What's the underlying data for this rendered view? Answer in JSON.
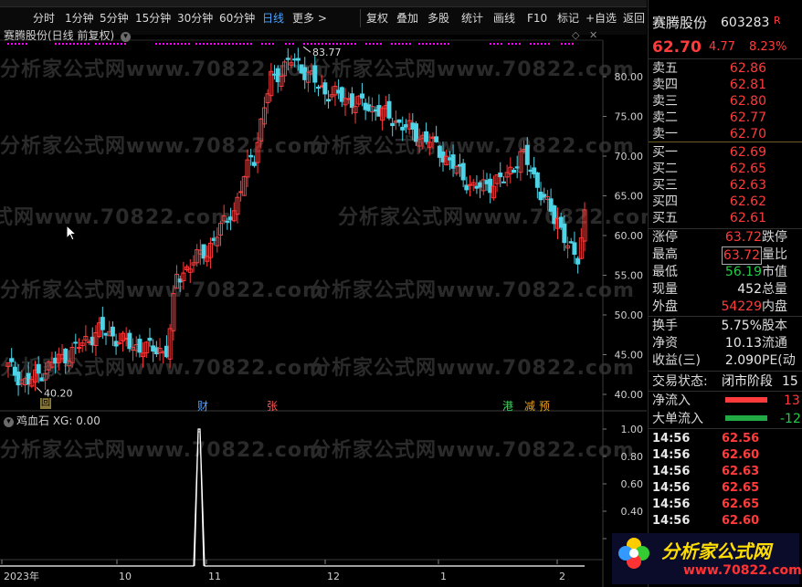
{
  "toolbar": {
    "periods": [
      "分时",
      "1分钟",
      "5分钟",
      "15分钟",
      "30分钟",
      "60分钟",
      "日线",
      "更多 >"
    ],
    "active_period": "日线",
    "actions": [
      "复权",
      "叠加",
      "多股",
      "统计",
      "画线",
      "F10",
      "标记",
      "+自选",
      "返回"
    ]
  },
  "chart": {
    "title": "赛腾股份(日线 前复权)",
    "high_label": "83.77",
    "low_label": "40.20",
    "y_ticks": [
      "80.00",
      "75.00",
      "70.00",
      "65.00",
      "60.00",
      "55.00",
      "50.00",
      "45.00",
      "40.00"
    ],
    "events": [
      "回",
      "财",
      "张",
      "港",
      "减",
      "预"
    ],
    "indicator_title": "鸡血石 XG: 0.00",
    "indicator_ticks": [
      "1.00",
      "0.80",
      "0.60",
      "0.40",
      "0.20"
    ],
    "x_labels": [
      "2023年",
      "10",
      "11",
      "12",
      "1",
      "2"
    ],
    "watermark": "分析家公式网www.70822.com",
    "colors": {
      "up": "#ff3b3b",
      "down": "#4fd3e6",
      "dots": "#ff00ff",
      "bg": "#000000"
    }
  },
  "panel": {
    "name": "赛腾股份",
    "code": "603283",
    "flag": "R",
    "price": "62.70",
    "change": "4.77",
    "pct": "8.23%",
    "asks": [
      {
        "label": "卖五",
        "price": "62.86"
      },
      {
        "label": "卖四",
        "price": "62.81"
      },
      {
        "label": "卖三",
        "price": "62.80"
      },
      {
        "label": "卖二",
        "price": "62.77"
      },
      {
        "label": "卖一",
        "price": "62.70"
      }
    ],
    "bids": [
      {
        "label": "买一",
        "price": "62.69"
      },
      {
        "label": "买二",
        "price": "62.65"
      },
      {
        "label": "买三",
        "price": "62.63"
      },
      {
        "label": "买四",
        "price": "62.62"
      },
      {
        "label": "买五",
        "price": "62.61"
      }
    ],
    "stats": [
      {
        "l": "涨停",
        "v": "63.72",
        "r": "跌停",
        "c": "red"
      },
      {
        "l": "最高",
        "v": "63.72",
        "r": "量比",
        "c": "red"
      },
      {
        "l": "最低",
        "v": "56.19",
        "r": "市值",
        "c": "green"
      },
      {
        "l": "现量",
        "v": "452",
        "r": "总量",
        "c": "white"
      },
      {
        "l": "外盘",
        "v": "54229",
        "r": "内盘",
        "c": "red"
      }
    ],
    "stats2": [
      {
        "l": "换手",
        "v": "5.75%",
        "r": "股本",
        "c": "white"
      },
      {
        "l": "净资",
        "v": "10.13",
        "r": "流通",
        "c": "white"
      },
      {
        "l": "收益(三)",
        "v": "2.090",
        "r": "PE(动",
        "c": "white"
      }
    ],
    "status_label": "交易状态:",
    "status_value": "闭市阶段",
    "status_num": "15",
    "flows": [
      {
        "label": "净流入",
        "value": "13",
        "color": "red"
      },
      {
        "label": "大单流入",
        "value": "-12",
        "color": "green"
      }
    ],
    "ticks": [
      {
        "t": "14:56",
        "p": "62.56"
      },
      {
        "t": "14:56",
        "p": "62.60"
      },
      {
        "t": "14:56",
        "p": "62.63"
      },
      {
        "t": "14:56",
        "p": "62.65"
      },
      {
        "t": "14:56",
        "p": "62.65"
      },
      {
        "t": "14:56",
        "p": "62.60"
      }
    ],
    "logo_text": "分析家公式网",
    "logo_url": "www.70822.com"
  }
}
